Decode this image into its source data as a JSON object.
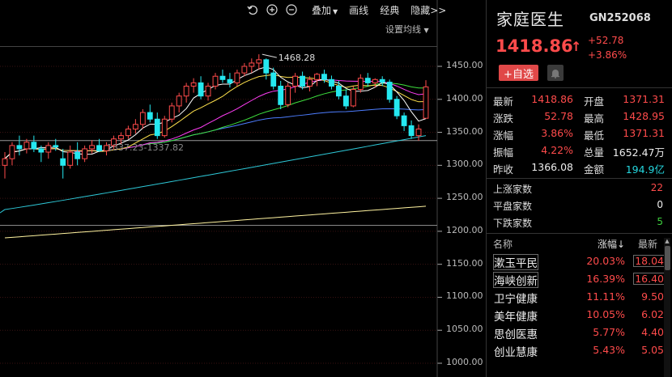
{
  "toolbar": {
    "overlay_label": "叠加",
    "drawline_label": "画线",
    "classic_label": "经典",
    "hide_label": "隐藏>>"
  },
  "chart": {
    "ma_setting_label": "设置均线",
    "high_annotation": "1468.28",
    "low_annotation": "1337.23-1337.82",
    "y_ticks": [
      "1450.00",
      "1400.00",
      "1350.00",
      "1300.00",
      "1250.00",
      "1200.00",
      "1150.00",
      "1100.00",
      "1050.00",
      "1000.00"
    ],
    "colors": {
      "up": "#ff4b4b",
      "down": "#25e8f0",
      "ma5": "#ffffff",
      "ma10": "#ffe14d",
      "ma20": "#ff3df5",
      "ma30": "#3ee03e",
      "ma60": "#4d7dff",
      "ma120": "#2ec9d8",
      "ma250": "#fff3a0"
    }
  },
  "chart_data": {
    "type": "candlestick",
    "ylim": [
      1000,
      1480
    ],
    "candles": [
      [
        1300,
        1320,
        1280,
        1310
      ],
      [
        1310,
        1335,
        1300,
        1330
      ],
      [
        1330,
        1345,
        1315,
        1325
      ],
      [
        1325,
        1340,
        1318,
        1335
      ],
      [
        1335,
        1345,
        1320,
        1325
      ],
      [
        1325,
        1330,
        1305,
        1320
      ],
      [
        1320,
        1335,
        1310,
        1330
      ],
      [
        1330,
        1340,
        1322,
        1328
      ],
      [
        1310,
        1325,
        1280,
        1300
      ],
      [
        1300,
        1330,
        1295,
        1320
      ],
      [
        1320,
        1335,
        1300,
        1310
      ],
      [
        1310,
        1330,
        1305,
        1325
      ],
      [
        1325,
        1338,
        1318,
        1330
      ],
      [
        1330,
        1340,
        1320,
        1322
      ],
      [
        1322,
        1335,
        1315,
        1330
      ],
      [
        1330,
        1345,
        1325,
        1340
      ],
      [
        1340,
        1350,
        1332,
        1345
      ],
      [
        1345,
        1360,
        1340,
        1355
      ],
      [
        1355,
        1370,
        1348,
        1362
      ],
      [
        1362,
        1385,
        1355,
        1380
      ],
      [
        1380,
        1392,
        1365,
        1370
      ],
      [
        1370,
        1380,
        1340,
        1345
      ],
      [
        1345,
        1375,
        1342,
        1370
      ],
      [
        1370,
        1395,
        1365,
        1390
      ],
      [
        1390,
        1410,
        1380,
        1405
      ],
      [
        1405,
        1425,
        1395,
        1420
      ],
      [
        1420,
        1432,
        1410,
        1425
      ],
      [
        1425,
        1435,
        1400,
        1405
      ],
      [
        1405,
        1425,
        1398,
        1420
      ],
      [
        1420,
        1440,
        1415,
        1435
      ],
      [
        1435,
        1445,
        1425,
        1430
      ],
      [
        1430,
        1440,
        1418,
        1425
      ],
      [
        1425,
        1445,
        1420,
        1440
      ],
      [
        1440,
        1455,
        1435,
        1450
      ],
      [
        1450,
        1462,
        1440,
        1455
      ],
      [
        1455,
        1468.28,
        1445,
        1460
      ],
      [
        1460,
        1462,
        1430,
        1440
      ],
      [
        1440,
        1448,
        1415,
        1420
      ],
      [
        1420,
        1428,
        1385,
        1392
      ],
      [
        1392,
        1425,
        1388,
        1420
      ],
      [
        1420,
        1440,
        1410,
        1435
      ],
      [
        1435,
        1442,
        1415,
        1420
      ],
      [
        1420,
        1435,
        1412,
        1430
      ],
      [
        1430,
        1440,
        1420,
        1438
      ],
      [
        1438,
        1445,
        1425,
        1430
      ],
      [
        1430,
        1436,
        1415,
        1420
      ],
      [
        1420,
        1428,
        1400,
        1405
      ],
      [
        1405,
        1415,
        1385,
        1390
      ],
      [
        1390,
        1420,
        1388,
        1415
      ],
      [
        1415,
        1438,
        1410,
        1432
      ],
      [
        1432,
        1440,
        1420,
        1425
      ],
      [
        1425,
        1432,
        1418,
        1430
      ],
      [
        1430,
        1435,
        1420,
        1426
      ],
      [
        1426,
        1430,
        1395,
        1400
      ],
      [
        1400,
        1405,
        1370,
        1375
      ],
      [
        1375,
        1380,
        1352,
        1360
      ],
      [
        1360,
        1368,
        1340,
        1345
      ],
      [
        1345,
        1362,
        1337.23,
        1355
      ],
      [
        1371.31,
        1428.95,
        1371.31,
        1418.86
      ]
    ]
  },
  "panel": {
    "name": "家庭医生",
    "code": "GN252068",
    "price": "1418.86",
    "price_arrow": "↑",
    "change": "+52.78",
    "change_pct": "+3.86%",
    "add_watch": "+自选",
    "stats": [
      {
        "l1": "最新",
        "v1": "1418.86",
        "c1": "red",
        "l2": "开盘",
        "v2": "1371.31",
        "c2": "red"
      },
      {
        "l1": "涨跌",
        "v1": "52.78",
        "c1": "red",
        "l2": "最高",
        "v2": "1428.95",
        "c2": "red"
      },
      {
        "l1": "涨幅",
        "v1": "3.86%",
        "c1": "red",
        "l2": "最低",
        "v2": "1371.31",
        "c2": "red"
      },
      {
        "l1": "振幅",
        "v1": "4.22%",
        "c1": "red",
        "l2": "总量",
        "v2": "1652.47万",
        "c2": "white"
      },
      {
        "l1": "昨收",
        "v1": "1366.08",
        "c1": "white",
        "l2": "金额",
        "v2": "194.9亿",
        "c2": "cyan"
      }
    ],
    "counts": [
      {
        "label": "上涨家数",
        "value": "22",
        "color": "red"
      },
      {
        "label": "平盘家数",
        "value": "0",
        "color": "white"
      },
      {
        "label": "下跌家数",
        "value": "5",
        "color": "green"
      }
    ],
    "list_header": {
      "name": "名称",
      "pct": "涨幅↓",
      "latest": "最新"
    },
    "list": [
      {
        "name": "漱玉平民",
        "pct": "20.03%",
        "latest": "18.04"
      },
      {
        "name": "海峡创新",
        "pct": "16.39%",
        "latest": "16.40"
      },
      {
        "name": "卫宁健康",
        "pct": "11.11%",
        "latest": "9.50"
      },
      {
        "name": "美年健康",
        "pct": "10.05%",
        "latest": "6.02"
      },
      {
        "name": "思创医惠",
        "pct": "5.77%",
        "latest": "4.40"
      },
      {
        "name": "创业慧康",
        "pct": "5.43%",
        "latest": "5.05"
      }
    ]
  }
}
